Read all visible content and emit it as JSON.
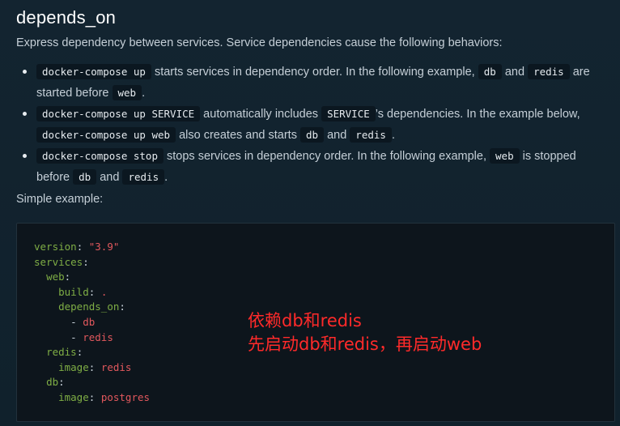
{
  "heading": "depends_on",
  "intro": "Express dependency between services. Service dependencies cause the following behaviors:",
  "bullets": [
    {
      "c1": "docker-compose up",
      "t1": " starts services in dependency order. In the following example, ",
      "c2": "db",
      "t2": " and ",
      "c3": "redis",
      "t3": " are started before ",
      "c4": "web",
      "t4": "."
    },
    {
      "c1": "docker-compose up SERVICE",
      "t1": " automatically includes ",
      "c2": "SERVICE",
      "t2": "’s dependencies. In the example below, ",
      "c3": "docker-compose up web",
      "t3": " also creates and starts ",
      "c4": "db",
      "t4": " and ",
      "c5": "redis",
      "t5": "."
    },
    {
      "c1": "docker-compose stop",
      "t1": " stops services in dependency order. In the following example, ",
      "c2": "web",
      "t2": " is stopped before ",
      "c3": "db",
      "t3": " and ",
      "c4": "redis",
      "t4": "."
    }
  ],
  "simple_example": "Simple example:",
  "code": {
    "l1_key": "version",
    "l1_val": "\"3.9\"",
    "l2_key": "services",
    "l3_key": "web",
    "l4_key": "build",
    "l4_val": ".",
    "l5_key": "depends_on",
    "l6_item": "db",
    "l7_item": "redis",
    "l8_key": "redis",
    "l9_key": "image",
    "l9_val": "redis",
    "l10_key": "db",
    "l11_key": "image",
    "l11_val": "postgres"
  },
  "annotation": {
    "line1": "依赖db和redis",
    "line2": "先启动db和redis，再启动web"
  },
  "colors": {
    "key": "#7fae45",
    "string": "#e2585d",
    "annotation": "#ff2a2a"
  }
}
